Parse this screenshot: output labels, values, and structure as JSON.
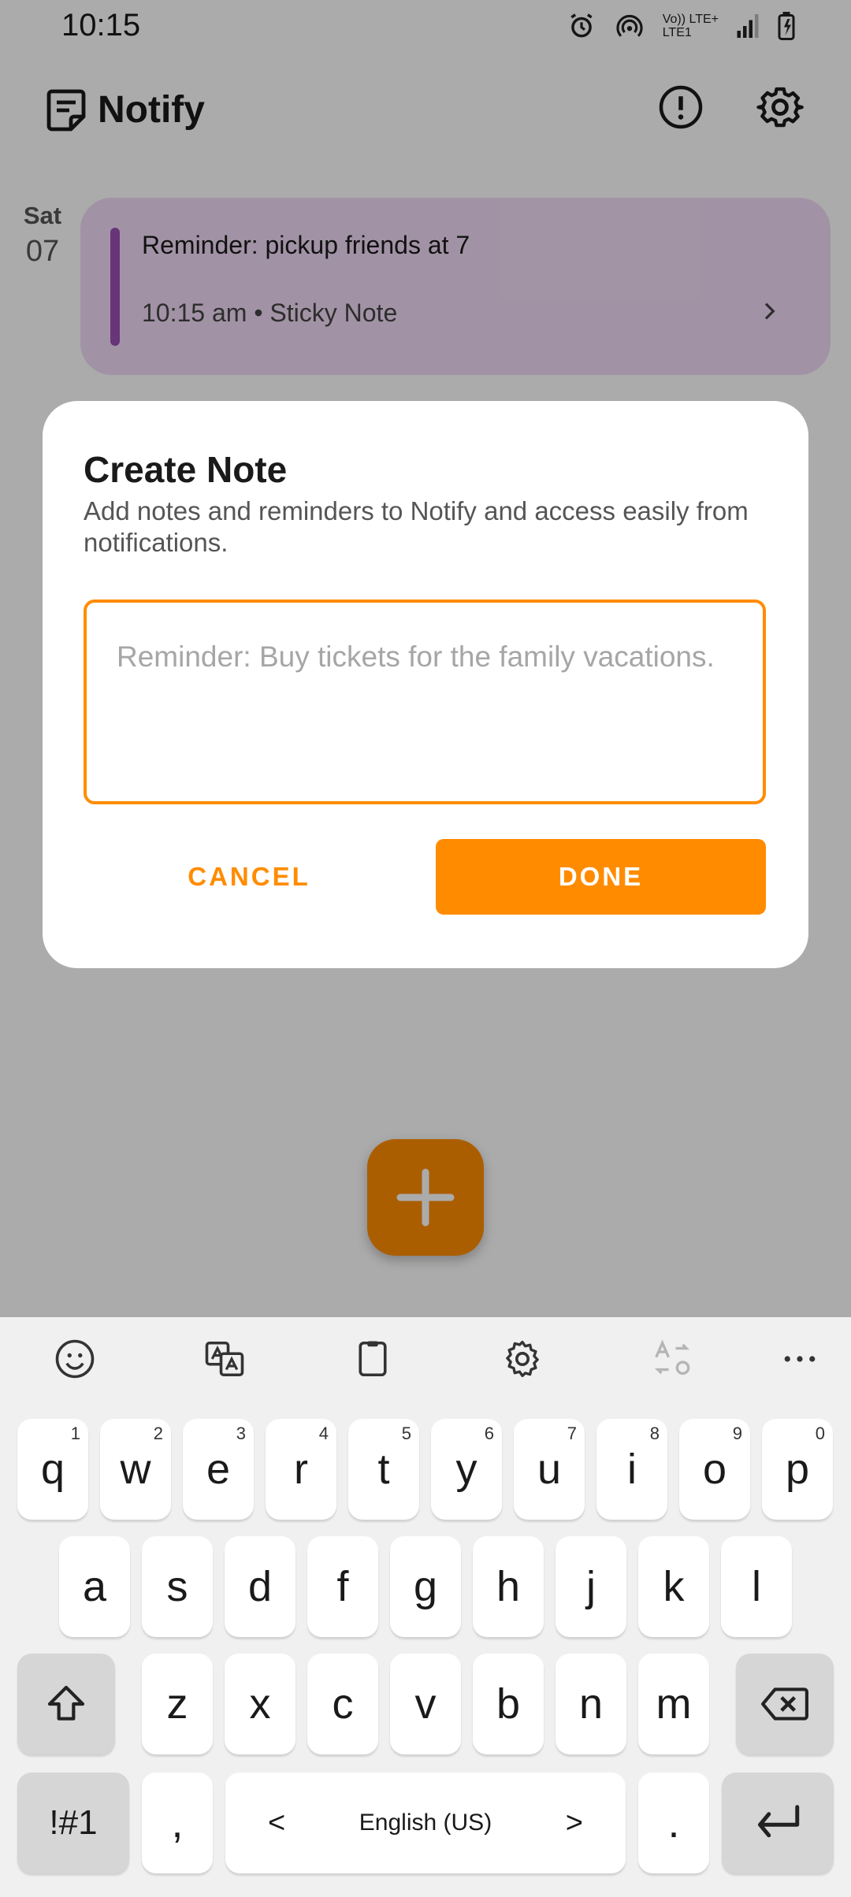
{
  "status_bar": {
    "time": "10:15",
    "network_label_top": "Vo)) LTE+",
    "network_label_bottom": "LTE1"
  },
  "app": {
    "title": "Notify"
  },
  "notes": [
    {
      "day": "Sat",
      "date": "07",
      "text": "Reminder: pickup friends at 7",
      "meta": "10:15 am • Sticky Note"
    }
  ],
  "dialog": {
    "title": "Create Note",
    "description": "Add notes and reminders to Notify and access easily from notifications.",
    "input_placeholder": "Reminder: Buy tickets for the family vacations.",
    "input_value": "",
    "cancel_label": "CANCEL",
    "done_label": "DONE"
  },
  "keyboard": {
    "row1": [
      {
        "k": "q",
        "h": "1"
      },
      {
        "k": "w",
        "h": "2"
      },
      {
        "k": "e",
        "h": "3"
      },
      {
        "k": "r",
        "h": "4"
      },
      {
        "k": "t",
        "h": "5"
      },
      {
        "k": "y",
        "h": "6"
      },
      {
        "k": "u",
        "h": "7"
      },
      {
        "k": "i",
        "h": "8"
      },
      {
        "k": "o",
        "h": "9"
      },
      {
        "k": "p",
        "h": "0"
      }
    ],
    "row2": [
      "a",
      "s",
      "d",
      "f",
      "g",
      "h",
      "j",
      "k",
      "l"
    ],
    "row3": [
      "z",
      "x",
      "c",
      "v",
      "b",
      "n",
      "m"
    ],
    "symbols_label": "!#1",
    "comma": ",",
    "period": ".",
    "space_label": "English (US)",
    "space_left": "<",
    "space_right": ">"
  },
  "colors": {
    "accent": "#ff8c00",
    "note_bg": "#f1dcf6",
    "note_bar": "#9c4fb3"
  },
  "icons": {
    "toolbar": [
      "notify-logo-icon",
      "info-icon",
      "settings-icon"
    ],
    "keyboard_toolbar": [
      "emoji-icon",
      "translate-icon",
      "clipboard-icon",
      "keyboard-settings-icon",
      "text-convert-icon",
      "more-icon"
    ]
  }
}
